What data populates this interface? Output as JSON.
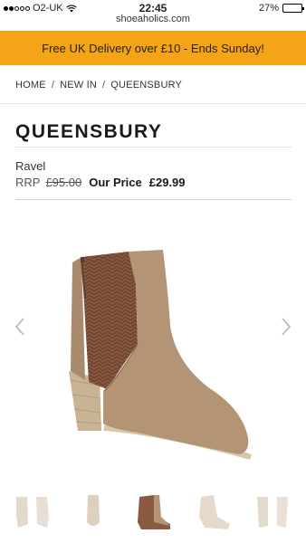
{
  "status_bar": {
    "carrier": "O2-UK",
    "time": "22:45",
    "battery": "27%",
    "battery_level": 0.27,
    "url": "shoeaholics.com",
    "wifi_icon": "wifi-icon"
  },
  "promo": {
    "text": "Free UK Delivery over £10 - Ends Sunday!",
    "color": "#f5a417"
  },
  "breadcrumb": {
    "items": [
      "HOME",
      "NEW IN",
      "QUEENSBURY"
    ],
    "separator": "/"
  },
  "product": {
    "title": "QUEENSBURY",
    "brand": "Ravel",
    "rrp_label": "RRP",
    "rrp_value": "£95.00",
    "our_price_label": "Our Price",
    "our_price_value": "£29.99"
  },
  "gallery": {
    "prev_icon": "chevron-left-icon",
    "next_icon": "chevron-right-icon",
    "thumbnail_count": 5,
    "selected_thumbnail": 3
  }
}
